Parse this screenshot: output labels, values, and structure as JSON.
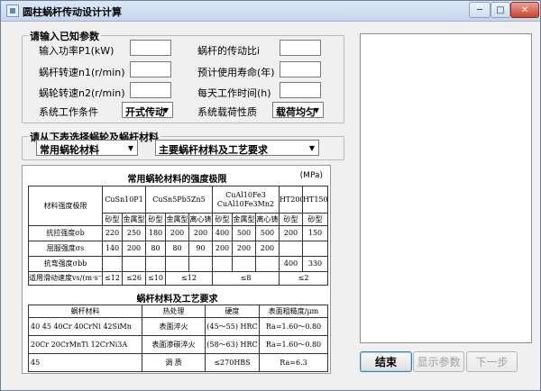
{
  "window": {
    "title": "圆柱蜗杆传动设计计算",
    "min_glyph": "─",
    "max_glyph": "□",
    "close_glyph": "✕"
  },
  "known_params": {
    "title": "请输入已知参数",
    "input_power": {
      "label": "输入功率P1(kW)",
      "value": ""
    },
    "worm_speed": {
      "label": "蜗杆转速n1(r/min)",
      "value": ""
    },
    "wheel_speed": {
      "label": "蜗轮转速n2(r/min)",
      "value": ""
    },
    "working_condition": {
      "label": "系统工作条件",
      "value": "开式传动"
    },
    "ratio": {
      "label": "蜗杆的传动比i",
      "value": ""
    },
    "life": {
      "label": "预计使用寿命(年)",
      "value": ""
    },
    "daily_hours": {
      "label": "每天工作时间(h)",
      "value": ""
    },
    "load_nature": {
      "label": "系统载荷性质",
      "value": "载荷均匀"
    }
  },
  "material_select": {
    "title": "请从下表选择蜗轮及蜗杆材料",
    "wheel_material": {
      "value": "常用蜗轮材料"
    },
    "worm_material": {
      "value": "主要蜗杆材料及工艺要求"
    }
  },
  "table1": {
    "title": "常用蜗轮材料的强度极限",
    "unit": "(MPa)",
    "header_row1": [
      "材料强度极限",
      "CuSn10P1",
      "CuSn5Pb5Zn5",
      "CuAl10Fe3 CuAl10Fe3Mn2",
      "HT200",
      "HT150"
    ],
    "header_row2": [
      "砂型",
      "金属型",
      "砂型",
      "金属型",
      "离心铸",
      "砂型",
      "金属型",
      "离心铸",
      "砂型",
      "砂型"
    ],
    "rows": [
      [
        "抗拉强度σb",
        "220",
        "250",
        "180",
        "200",
        "200",
        "400",
        "500",
        "500",
        "200",
        "150"
      ],
      [
        "屈服强度σs",
        "140",
        "200",
        "80",
        "80",
        "90",
        "200",
        "200",
        "200",
        "",
        ""
      ],
      [
        "抗弯强度σbb",
        "",
        "",
        "",
        "",
        "",
        "",
        "",
        "",
        "400",
        "330"
      ]
    ],
    "speed_row": {
      "label": "适用滑动速度vs/(m·s⁻¹)",
      "vals": [
        "≤12",
        "≤26",
        "≤10",
        "≤12",
        "≤8",
        "≤2"
      ]
    }
  },
  "table2": {
    "title": "蜗杆材料及工艺要求",
    "header": [
      "蜗杆材料",
      "热处理",
      "硬度",
      "表面粗糙度/μm"
    ],
    "rows": [
      [
        "40  45  40Cr  40CrNi  42SiMn",
        "表面淬火",
        "(45～55) HRC",
        "Ra=1.60～0.80"
      ],
      [
        "20Cr  20CrMnTi  12CrNi3A",
        "表面渗碳淬火",
        "(58～63) HRC",
        "Ra=1.60～0.80"
      ],
      [
        "45",
        "调   质",
        "≤270HBS",
        "Ra=6.3"
      ]
    ]
  },
  "buttons": {
    "finish": "结束",
    "show_params": "显示参数",
    "next": "下一步"
  }
}
